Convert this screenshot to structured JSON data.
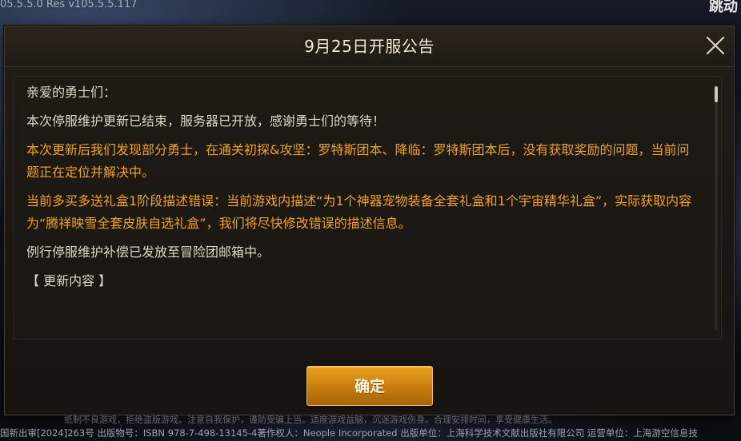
{
  "background": {
    "version_text": "05.5.5.0 Res v105.5.5.117",
    "skip_label": "跳动",
    "health_notice": "抵制不良游戏，拒绝盗版游戏。注意自我保护，谨防受骗上当。适度游戏益脑，沉迷游戏伤身。合理安排时间，享受健康生活。",
    "footer_text": "国新出审[2024]263号 出版物号：ISBN 978-7-498-13145-4著作权人：Neople Incorporated 出版单位：上海科学技术文献出版社有限公司 运营单位：上海游空信息技"
  },
  "modal": {
    "title": "9月25日开服公告",
    "close_icon": "close-icon",
    "paragraphs": [
      {
        "text": "亲爱的勇士们：",
        "color": "white"
      },
      {
        "text": "本次停服维护更新已结束，服务器已开放，感谢勇士们的等待！",
        "color": "white"
      },
      {
        "text": "本次更新后我们发现部分勇士，在通关初探&攻坚：罗特斯团本、降临：罗特斯团本后，没有获取奖励的问题，当前问题正在定位并解决中。",
        "color": "orange"
      },
      {
        "text": "当前多买多送礼盒1阶段描述错误：当前游戏内描述“为1个神器宠物装备全套礼盒和1个宇宙精华礼盒”，实际获取内容为“腾祥映雪全套皮肤自选礼盒”，我们将尽快修改错误的描述信息。",
        "color": "orange"
      },
      {
        "text": "例行停服维护补偿已发放至冒险团邮箱中。",
        "color": "white"
      },
      {
        "text": "【 更新内容 】",
        "color": "white"
      }
    ],
    "confirm_label": "确定"
  },
  "colors": {
    "accent_orange": "#f0a21b",
    "body_text": "#ddd6c7",
    "button_gold": "#d98d14"
  }
}
